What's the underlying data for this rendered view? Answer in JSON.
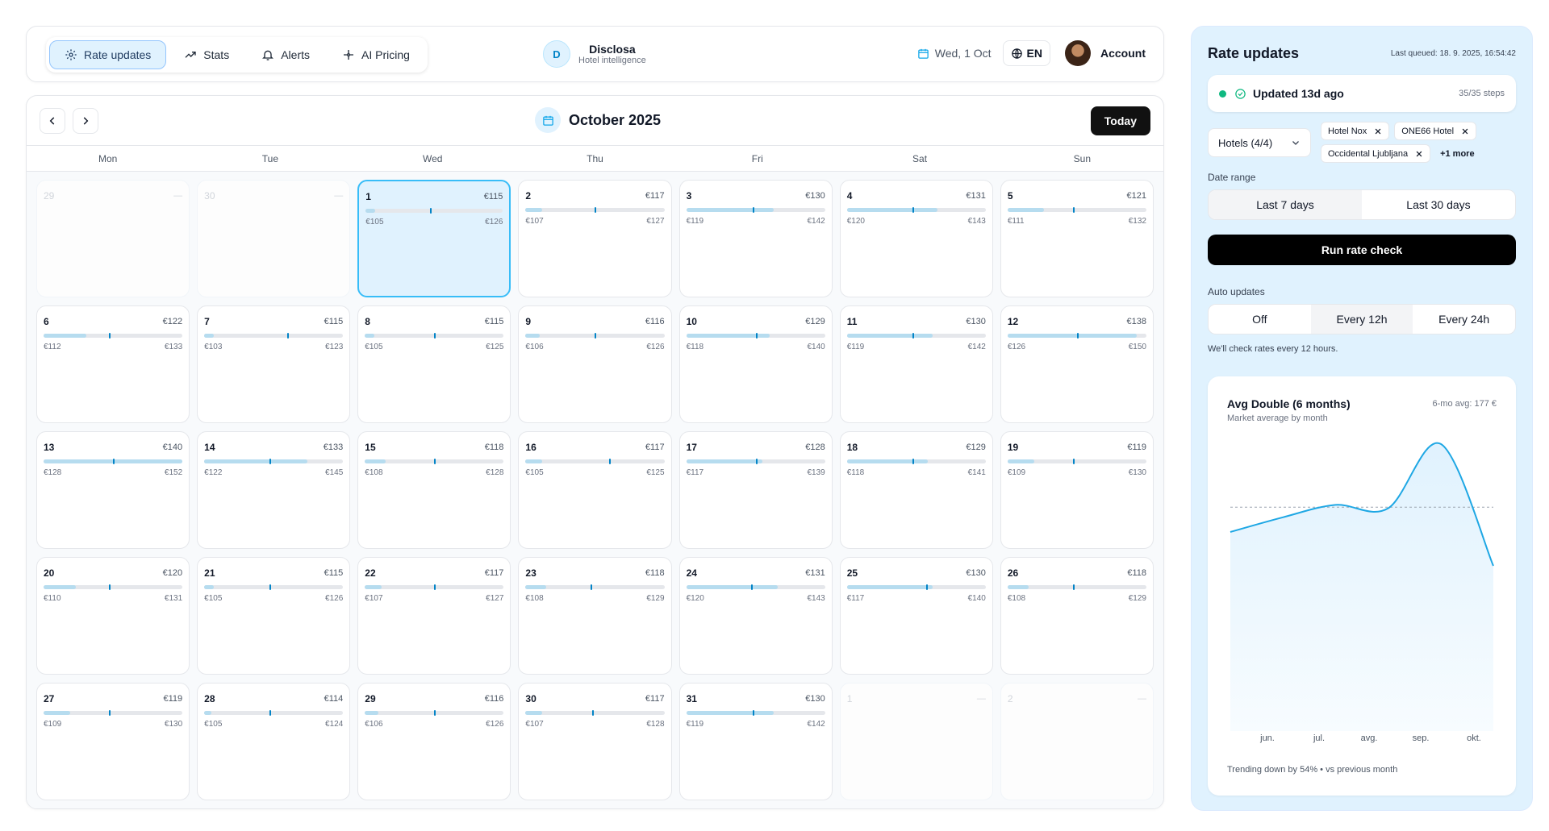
{
  "nav": {
    "tabs": [
      {
        "label": "Rate updates",
        "icon": "gear-icon",
        "active": true
      },
      {
        "label": "Stats",
        "icon": "trend-icon",
        "active": false
      },
      {
        "label": "Alerts",
        "icon": "bell-icon",
        "active": false
      },
      {
        "label": "AI Pricing",
        "icon": "sparkle-icon",
        "active": false
      }
    ]
  },
  "brand": {
    "initial": "D",
    "name": "Disclosa",
    "tagline": "Hotel intelligence"
  },
  "header": {
    "date": "Wed, 1 Oct",
    "lang": "EN",
    "account": "Account"
  },
  "calendar": {
    "month": "October 2025",
    "today_label": "Today",
    "weekdays": [
      "Mon",
      "Tue",
      "Wed",
      "Thu",
      "Fri",
      "Sat",
      "Sun"
    ],
    "days": [
      {
        "n": "29",
        "out": true,
        "price": "—"
      },
      {
        "n": "30",
        "out": true,
        "price": "—"
      },
      {
        "n": "1",
        "price": "€115",
        "min": "€105",
        "max": "€126",
        "fill": 0.07,
        "mark": 0.47,
        "selected": true
      },
      {
        "n": "2",
        "price": "€117",
        "min": "€107",
        "max": "€127",
        "fill": 0.12,
        "mark": 0.5
      },
      {
        "n": "3",
        "price": "€130",
        "min": "€119",
        "max": "€142",
        "fill": 0.63,
        "mark": 0.48
      },
      {
        "n": "4",
        "price": "€131",
        "min": "€120",
        "max": "€143",
        "fill": 0.65,
        "mark": 0.47
      },
      {
        "n": "5",
        "price": "€121",
        "min": "€111",
        "max": "€132",
        "fill": 0.26,
        "mark": 0.47
      },
      {
        "n": "6",
        "price": "€122",
        "min": "€112",
        "max": "€133",
        "fill": 0.31,
        "mark": 0.47
      },
      {
        "n": "7",
        "price": "€115",
        "min": "€103",
        "max": "€123",
        "fill": 0.07,
        "mark": 0.6
      },
      {
        "n": "8",
        "price": "€115",
        "min": "€105",
        "max": "€125",
        "fill": 0.07,
        "mark": 0.5
      },
      {
        "n": "9",
        "price": "€116",
        "min": "€106",
        "max": "€126",
        "fill": 0.1,
        "mark": 0.5
      },
      {
        "n": "10",
        "price": "€129",
        "min": "€118",
        "max": "€140",
        "fill": 0.6,
        "mark": 0.5
      },
      {
        "n": "11",
        "price": "€130",
        "min": "€119",
        "max": "€142",
        "fill": 0.62,
        "mark": 0.47
      },
      {
        "n": "12",
        "price": "€138",
        "min": "€126",
        "max": "€150",
        "fill": 0.93,
        "mark": 0.5
      },
      {
        "n": "13",
        "price": "€140",
        "min": "€128",
        "max": "€152",
        "fill": 1.0,
        "mark": 0.5
      },
      {
        "n": "14",
        "price": "€133",
        "min": "€122",
        "max": "€145",
        "fill": 0.74,
        "mark": 0.47
      },
      {
        "n": "15",
        "price": "€118",
        "min": "€108",
        "max": "€128",
        "fill": 0.15,
        "mark": 0.5
      },
      {
        "n": "16",
        "price": "€117",
        "min": "€105",
        "max": "€125",
        "fill": 0.12,
        "mark": 0.6
      },
      {
        "n": "17",
        "price": "€128",
        "min": "€117",
        "max": "€139",
        "fill": 0.55,
        "mark": 0.5
      },
      {
        "n": "18",
        "price": "€129",
        "min": "€118",
        "max": "€141",
        "fill": 0.58,
        "mark": 0.47
      },
      {
        "n": "19",
        "price": "€119",
        "min": "€109",
        "max": "€130",
        "fill": 0.19,
        "mark": 0.47
      },
      {
        "n": "20",
        "price": "€120",
        "min": "€110",
        "max": "€131",
        "fill": 0.23,
        "mark": 0.47
      },
      {
        "n": "21",
        "price": "€115",
        "min": "€105",
        "max": "€126",
        "fill": 0.07,
        "mark": 0.47
      },
      {
        "n": "22",
        "price": "€117",
        "min": "€107",
        "max": "€127",
        "fill": 0.12,
        "mark": 0.5
      },
      {
        "n": "23",
        "price": "€118",
        "min": "€108",
        "max": "€129",
        "fill": 0.15,
        "mark": 0.47
      },
      {
        "n": "24",
        "price": "€131",
        "min": "€120",
        "max": "€143",
        "fill": 0.66,
        "mark": 0.47
      },
      {
        "n": "25",
        "price": "€130",
        "min": "€117",
        "max": "€140",
        "fill": 0.62,
        "mark": 0.57
      },
      {
        "n": "26",
        "price": "€118",
        "min": "€108",
        "max": "€129",
        "fill": 0.15,
        "mark": 0.47
      },
      {
        "n": "27",
        "price": "€119",
        "min": "€109",
        "max": "€130",
        "fill": 0.19,
        "mark": 0.47
      },
      {
        "n": "28",
        "price": "€114",
        "min": "€105",
        "max": "€124",
        "fill": 0.05,
        "mark": 0.47
      },
      {
        "n": "29",
        "price": "€116",
        "min": "€106",
        "max": "€126",
        "fill": 0.1,
        "mark": 0.5
      },
      {
        "n": "30",
        "price": "€117",
        "min": "€107",
        "max": "€128",
        "fill": 0.12,
        "mark": 0.48
      },
      {
        "n": "31",
        "price": "€130",
        "min": "€119",
        "max": "€142",
        "fill": 0.63,
        "mark": 0.48
      },
      {
        "n": "1",
        "out": true,
        "price": "—"
      },
      {
        "n": "2",
        "out": true,
        "price": "—"
      }
    ]
  },
  "panel": {
    "title": "Rate updates",
    "last_queued": "Last queued: 18. 9. 2025, 16:54:42",
    "status": {
      "text": "Updated 13d ago",
      "steps": "35/35 steps"
    },
    "hotels_label": "Hotels (4/4)",
    "hotel_chips": [
      "Hotel Nox",
      "ONE66 Hotel",
      "Occidental Ljubljana"
    ],
    "more_label": "+1 more",
    "date_range_label": "Date range",
    "date_range_options": [
      {
        "label": "Last 7 days",
        "active": true
      },
      {
        "label": "Last 30 days",
        "active": false
      }
    ],
    "run_label": "Run rate check",
    "auto_label": "Auto updates",
    "auto_options": [
      {
        "label": "Off",
        "active": false
      },
      {
        "label": "Every 12h",
        "active": true
      },
      {
        "label": "Every 24h",
        "active": false
      }
    ],
    "hint": "We'll check rates every 12 hours."
  },
  "chart_data": {
    "type": "area",
    "title": "Avg Double (6 months)",
    "subtitle": "Market average by month",
    "annotation": "6-mo avg: 177 €",
    "x": [
      "jun.",
      "jul.",
      "avg.",
      "sep.",
      "okt."
    ],
    "series": [
      {
        "values": [
          155,
          168,
          179,
          176,
          233,
          125
        ]
      }
    ],
    "x_positions": [
      0,
      1,
      2,
      3,
      4,
      5
    ],
    "average": 177,
    "ylim": [
      0,
      250
    ],
    "footer": "Trending down by 54% • vs previous month",
    "colors": {
      "line": "#1ea7e4",
      "fill": "#e0f2fe",
      "avg_line": "#9ca3af"
    }
  },
  "colors": {
    "accent": "#38bdf8",
    "selected_bg": "#e0f2fe",
    "bar_fill": "#b6dcef",
    "bar_mark": "#0284c7"
  }
}
